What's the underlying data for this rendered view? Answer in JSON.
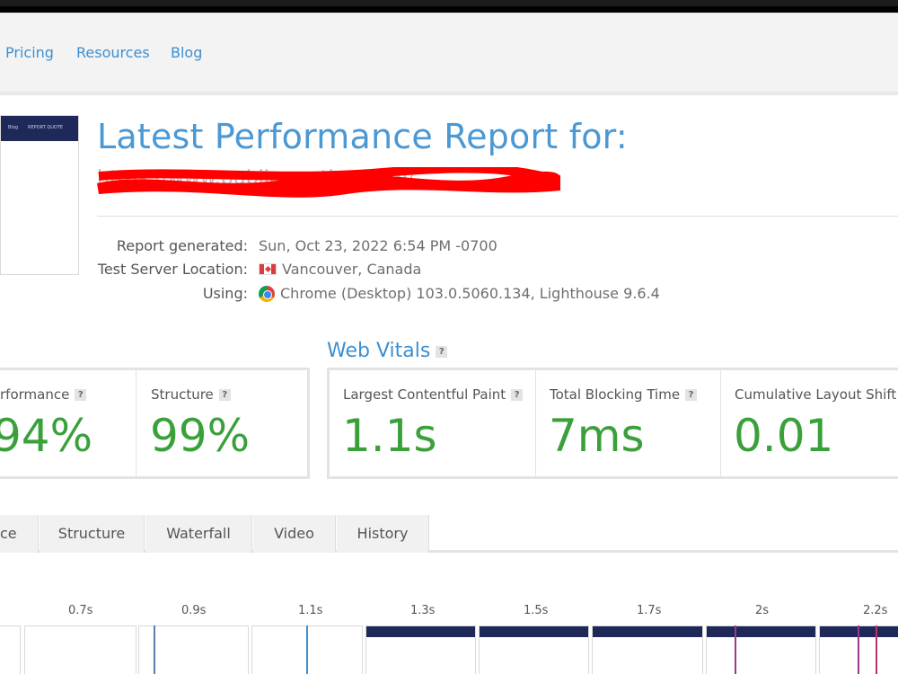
{
  "nav": {
    "links": [
      "Pricing",
      "Resources",
      "Blog"
    ]
  },
  "thumbnail": {
    "nav_items": [
      "Blog",
      "REPORT QUOTE"
    ]
  },
  "report": {
    "title": "Latest Performance Report for:",
    "url": "https://www.publicweather.com/"
  },
  "meta": {
    "generated_label": "Report generated:",
    "generated_value": "Sun, Oct 23, 2022 6:54 PM -0700",
    "location_label": "Test Server Location:",
    "location_value": "Vancouver, Canada",
    "using_label": "Using:",
    "using_value": "Chrome (Desktop) 103.0.5060.134, Lighthouse 9.6.4"
  },
  "grades": {
    "performance_label": "rformance",
    "performance_value": "94%",
    "structure_label": "Structure",
    "structure_value": "99%"
  },
  "web_vitals": {
    "title": "Web Vitals",
    "lcp_label": "Largest Contentful Paint",
    "lcp_value": "1.1s",
    "tbt_label": "Total Blocking Time",
    "tbt_value": "7ms",
    "cls_label": "Cumulative Layout Shift",
    "cls_value": "0.01"
  },
  "tabs": [
    "ce",
    "Structure",
    "Waterfall",
    "Video",
    "History"
  ],
  "filmstrip": {
    "times": [
      "0.7s",
      "0.9s",
      "1.1s",
      "1.3s",
      "1.5s",
      "1.7s",
      "2s",
      "2.2s"
    ]
  },
  "help_glyph": "?",
  "colors": {
    "accent_blue": "#3d8fd1",
    "grade_green": "#3aa03a",
    "site_header_navy": "#1e2859",
    "redaction_red": "#ff0000"
  }
}
